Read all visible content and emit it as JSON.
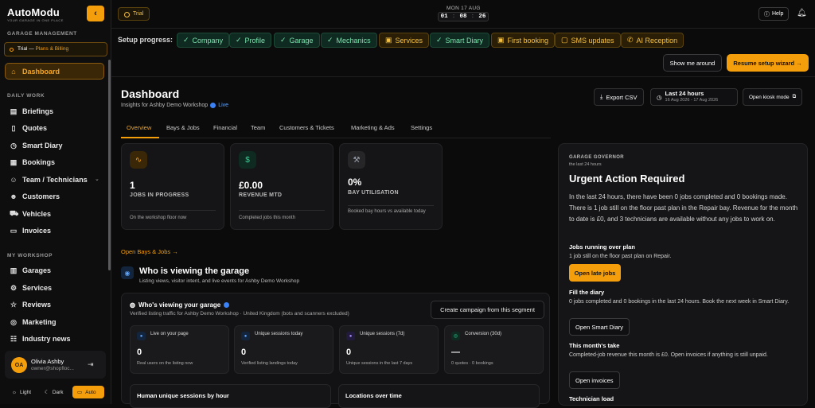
{
  "brand": {
    "logo": "AutoModu",
    "tagline": "YOUR GARAGE IN ONE PLACE"
  },
  "sidebar": {
    "section_garage_mgmt": "GARAGE MANAGEMENT",
    "trial_label": "Trial —",
    "trial_link": "Plans & Billing",
    "section_daily": "DAILY WORK",
    "section_workshop": "MY WORKSHOP",
    "items": [
      {
        "label": "Dashboard",
        "icon": "home-icon"
      },
      {
        "label": "Briefings",
        "icon": "book-icon"
      },
      {
        "label": "Quotes",
        "icon": "document-icon"
      },
      {
        "label": "Smart Diary",
        "icon": "clock-icon"
      },
      {
        "label": "Bookings",
        "icon": "calendar-icon"
      },
      {
        "label": "Team / Technicians",
        "icon": "users-icon"
      },
      {
        "label": "Customers",
        "icon": "user-group-icon"
      },
      {
        "label": "Vehicles",
        "icon": "truck-icon"
      },
      {
        "label": "Invoices",
        "icon": "invoice-icon"
      },
      {
        "label": "Garages",
        "icon": "building-icon"
      },
      {
        "label": "Services",
        "icon": "gear-icon"
      },
      {
        "label": "Reviews",
        "icon": "star-icon"
      },
      {
        "label": "Marketing",
        "icon": "target-icon"
      },
      {
        "label": "Industry news",
        "icon": "news-icon"
      }
    ],
    "user": {
      "initials": "OA",
      "name": "Olivia Ashby",
      "email": "owner@shopfloc..."
    },
    "theme": {
      "light": "Light",
      "dark": "Dark",
      "auto": "Auto"
    }
  },
  "topbar": {
    "trial": "Trial",
    "date": "MON 17 AUG",
    "clock": {
      "h": "01",
      "m": "08",
      "s": "26"
    },
    "help": "Help"
  },
  "setup": {
    "label": "Setup progress:",
    "steps": [
      {
        "label": "Company",
        "done": true
      },
      {
        "label": "Profile",
        "done": true
      },
      {
        "label": "Garage",
        "done": true
      },
      {
        "label": "Mechanics",
        "done": true
      },
      {
        "label": "Services",
        "done": false
      },
      {
        "label": "Smart Diary",
        "done": true
      },
      {
        "label": "First booking",
        "done": false
      },
      {
        "label": "SMS updates",
        "done": false
      },
      {
        "label": "AI Reception",
        "done": false
      }
    ],
    "show_me": "Show me around",
    "resume": "Resume setup wizard →"
  },
  "header": {
    "title": "Dashboard",
    "subtitle": "Insights for Ashby Demo Workshop",
    "live": "Live",
    "export": "Export CSV",
    "range_main": "Last 24 hours",
    "range_sub": "16 Aug 2026 - 17 Aug 2026",
    "kiosk": "Open kiosk mode"
  },
  "tabs": [
    "Overview",
    "Bays & Jobs",
    "Financial",
    "Team",
    "Customers & Tickets",
    "Marketing & Ads",
    "Settings"
  ],
  "kpis": [
    {
      "value": "1",
      "label": "JOBS IN PROGRESS",
      "foot": "On the workshop floor now",
      "icon": "pulse-icon",
      "accent": "#f59e0b",
      "tint": "#3a2708"
    },
    {
      "value": "£0.00",
      "label": "REVENUE MTD",
      "foot": "Completed jobs this month",
      "icon": "dollar-icon",
      "accent": "#34d399",
      "tint": "#0f2a20"
    },
    {
      "value": "0%",
      "label": "BAY UTILISATION",
      "foot": "Booked bay hours vs available today",
      "icon": "wrench-icon",
      "accent": "#9ca3af",
      "tint": "#262628"
    }
  ],
  "open_bays": "Open Bays & Jobs →",
  "who": {
    "title": "Who is viewing the garage",
    "subtitle": "Listing views, visitor intent, and live events for Ashby Demo Workshop",
    "card_title": "Who's viewing your garage",
    "card_sub": "Verified listing traffic for Ashby Demo Workshop · United Kingdom (bots and scanners excluded)",
    "campaign": "Create campaign from this segment",
    "metrics": [
      {
        "label": "Live on your page",
        "value": "0",
        "foot": "Real users on the listing now",
        "accent": "#60a5fa",
        "tint": "#13243d"
      },
      {
        "label": "Unique sessions today",
        "value": "0",
        "foot": "Verified listing landings today",
        "accent": "#60a5fa",
        "tint": "#13243d"
      },
      {
        "label": "Unique sessions (7d)",
        "value": "0",
        "foot": "Unique sessions in the last 7 days",
        "accent": "#a78bfa",
        "tint": "#221a3d"
      },
      {
        "label": "Conversion (30d)",
        "value": "—",
        "foot": "0 quotes · 0 bookings",
        "accent": "#34d399",
        "tint": "#0f2a20"
      }
    ],
    "hourly_title": "Human unique sessions by hour",
    "locations_title": "Locations over time"
  },
  "governor": {
    "eyebrow": "GARAGE GOVERNOR",
    "eyesub": "the last 24 hours",
    "title": "Urgent Action Required",
    "para": "In the last 24 hours, there have been 0 jobs completed and 0 bookings made. There is 1 job still on the floor past plan in the Repair bay. Revenue for the month to date is £0, and 3 technicians are available without any jobs to work on.",
    "s1_h": "Jobs running over plan",
    "s1_t": "1 job still on the floor past plan on Repair.",
    "s1_btn": "Open late jobs",
    "s2_h": "Fill the diary",
    "s2_t": "0 jobs completed and 0 bookings in the last 24 hours. Book the next week in Smart Diary.",
    "s2_btn": "Open Smart Diary",
    "s3_h": "This month's take",
    "s3_t": "Completed-job revenue this month is £0. Open invoices if anything is still unpaid.",
    "s3_btn": "Open invoices",
    "s4_h": "Technician load"
  },
  "colors": {
    "accent": "#f59e0b",
    "success": "#34d399",
    "info": "#3b82f6"
  }
}
